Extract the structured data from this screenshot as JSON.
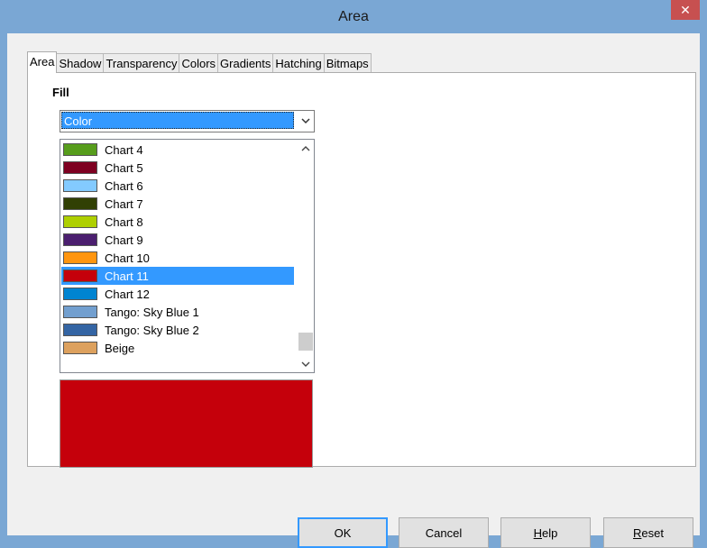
{
  "window": {
    "title": "Area",
    "close_glyph": "✕"
  },
  "tabs": [
    {
      "label": "Area",
      "active": true
    },
    {
      "label": "Shadow"
    },
    {
      "label": "Transparency"
    },
    {
      "label": "Colors"
    },
    {
      "label": "Gradients"
    },
    {
      "label": "Hatching"
    },
    {
      "label": "Bitmaps"
    }
  ],
  "fill": {
    "label": "Fill",
    "selected": "Color"
  },
  "colors": [
    {
      "name": "Chart 4",
      "color": "#579d1c"
    },
    {
      "name": "Chart 5",
      "color": "#7e0021"
    },
    {
      "name": "Chart 6",
      "color": "#83caff"
    },
    {
      "name": "Chart 7",
      "color": "#314004"
    },
    {
      "name": "Chart 8",
      "color": "#aecf00"
    },
    {
      "name": "Chart 9",
      "color": "#4b1f6f"
    },
    {
      "name": "Chart 10",
      "color": "#ff950e"
    },
    {
      "name": "Chart 11",
      "color": "#c5000b",
      "selected": true
    },
    {
      "name": "Chart 12",
      "color": "#0084d1"
    },
    {
      "name": "Tango: Sky Blue 1",
      "color": "#729fcf"
    },
    {
      "name": "Tango: Sky Blue 2",
      "color": "#3465a4"
    },
    {
      "name": "Beige",
      "color": "#dda15e"
    }
  ],
  "preview_color": "#c5000b",
  "buttons": {
    "ok": "OK",
    "cancel": "Cancel",
    "help_mnemonic": "H",
    "help_rest": "elp",
    "reset_mnemonic": "R",
    "reset_rest": "eset"
  }
}
